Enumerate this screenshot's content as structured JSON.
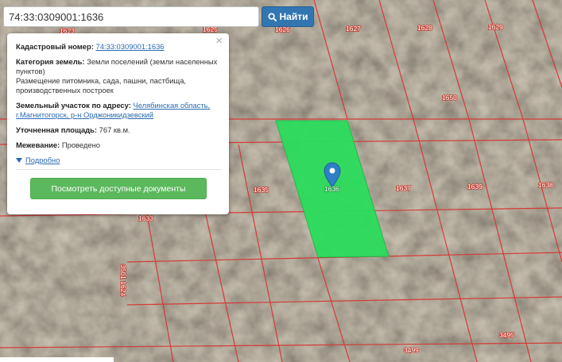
{
  "search": {
    "value": "74:33:0309001:1636",
    "button_label": "Найти"
  },
  "popup": {
    "close_symbol": "×",
    "cadastral_label": "Кадастровый номер:",
    "cadastral_value": "74:33:0309001:1636",
    "category_label": "Категория земель:",
    "category_value": "Земли поселений (земли населенных пунктов)",
    "usage_text": "Размещение питомника, сада, пашни, пастбища, производственных построек",
    "address_label": "Земельный участок по адресу:",
    "address_value": "Челябинская область, г.Магнитогорск, р-н Орджоникидзевский",
    "area_label": "Уточненная площадь:",
    "area_value": "767 кв.м.",
    "survey_label": "Межевание:",
    "survey_value": "Проведено",
    "more_label": "Подробно",
    "docs_button": "Посмотреть доступные документы"
  },
  "map": {
    "parcel_labels": {
      "p1623": "1623",
      "p1625": "1625",
      "p1626": "1626",
      "p1627": "1627",
      "p1628": "1628",
      "p1629": "1629",
      "p1650": "1650",
      "p1635": "1635",
      "p1637": "1637",
      "p1639": "1639",
      "p1638": "1638",
      "p1633": "1633",
      "p1624": "3501 1624",
      "p3495": "3495",
      "p3499": "3499",
      "selected": "1636"
    },
    "colors": {
      "boundary": "#d43a3a",
      "selected_fill": "#2bdd5c",
      "marker": "#2f7fc7"
    }
  }
}
